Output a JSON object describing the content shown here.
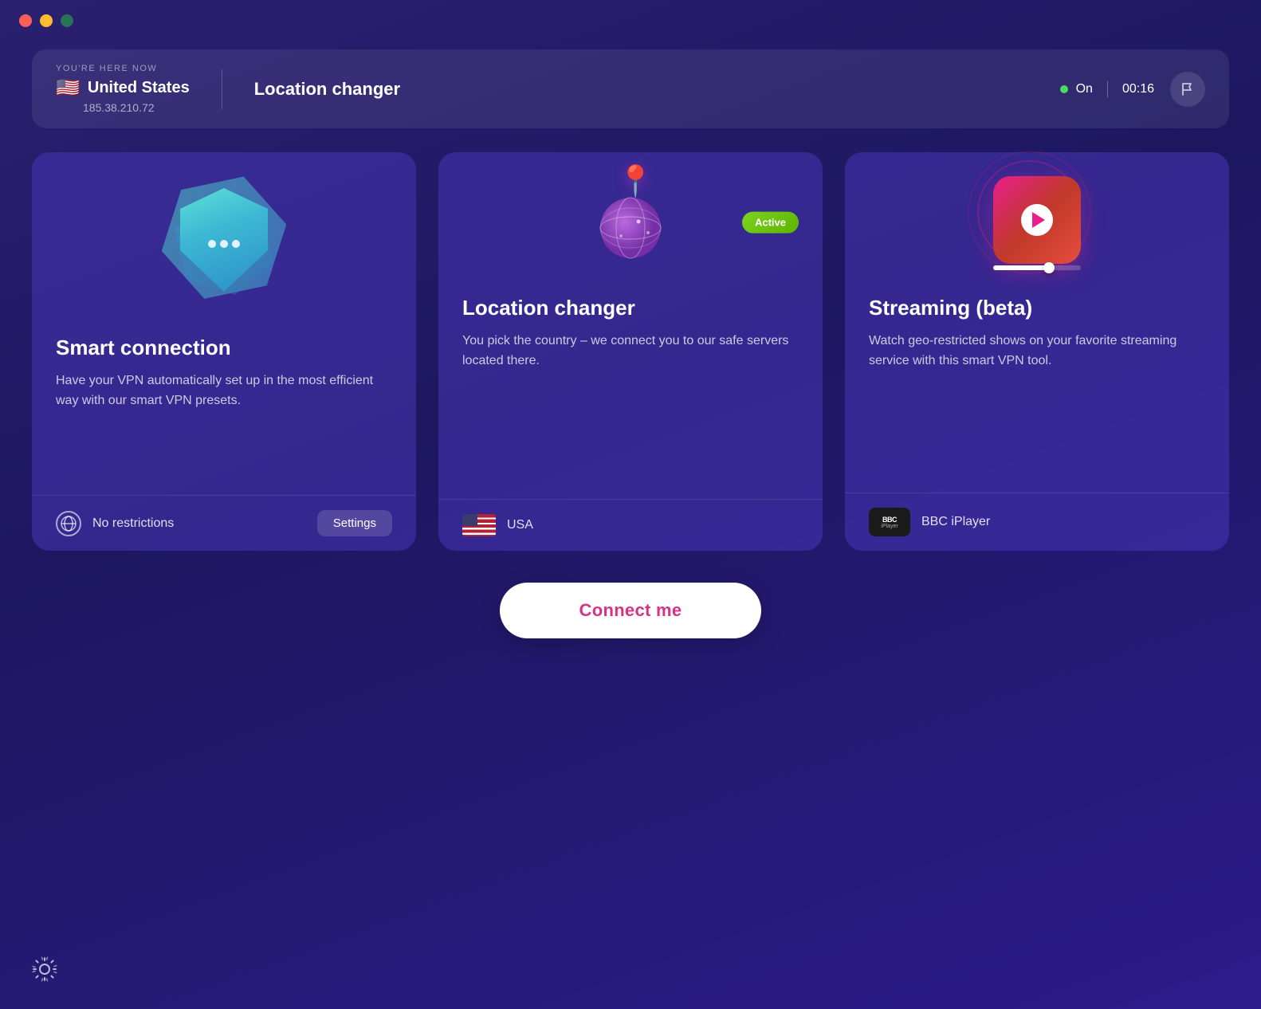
{
  "titlebar": {
    "close_btn": "close",
    "minimize_btn": "minimize",
    "maximize_btn": "maximize"
  },
  "header": {
    "you_are_here": "YOU'RE HERE NOW",
    "country": "United States",
    "ip": "185.38.210.72",
    "flag": "🇺🇸",
    "feature": "Location changer",
    "status": "On",
    "timer": "00:16"
  },
  "cards": {
    "smart": {
      "title": "Smart connection",
      "description": "Have your VPN automatically set up in the most efficient way with our smart VPN presets.",
      "footer_label": "No restrictions",
      "settings_btn": "Settings"
    },
    "location": {
      "title": "Location changer",
      "description": "You pick the country – we connect you to our safe servers located there.",
      "badge": "Active",
      "country": "USA"
    },
    "streaming": {
      "title": "Streaming (beta)",
      "description": "Watch geo-restricted shows on your favorite streaming service with this smart VPN tool.",
      "service": "BBC iPlayer"
    }
  },
  "connect_btn": "Connect me",
  "icons": {
    "gear": "⚙",
    "flag_report": "⚑"
  }
}
